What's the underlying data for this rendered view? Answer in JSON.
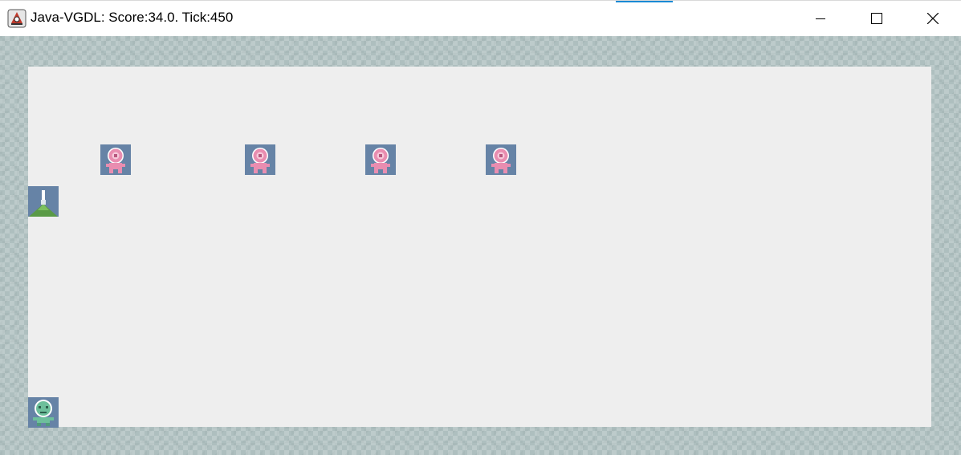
{
  "window": {
    "title": "Java-VGDL: Score:34.0. Tick:450",
    "controls": {
      "minimize": "minimize",
      "maximize": "maximize",
      "close": "close"
    }
  },
  "colors": {
    "wall": "#aebfbf",
    "floor": "#eeeeee",
    "sprite_bg": "#6683a6",
    "alien": "#e98db0",
    "avatar": "#6dbf9b",
    "cannon": "#5a9a46",
    "accent": "#1a8ad4"
  },
  "icons": {
    "app": "java-icon",
    "minimize": "minimize-icon",
    "maximize": "maximize-icon",
    "close": "close-icon",
    "alien": "pink-alien-icon",
    "cannon": "cannon-icon",
    "avatar": "green-alien-icon"
  }
}
